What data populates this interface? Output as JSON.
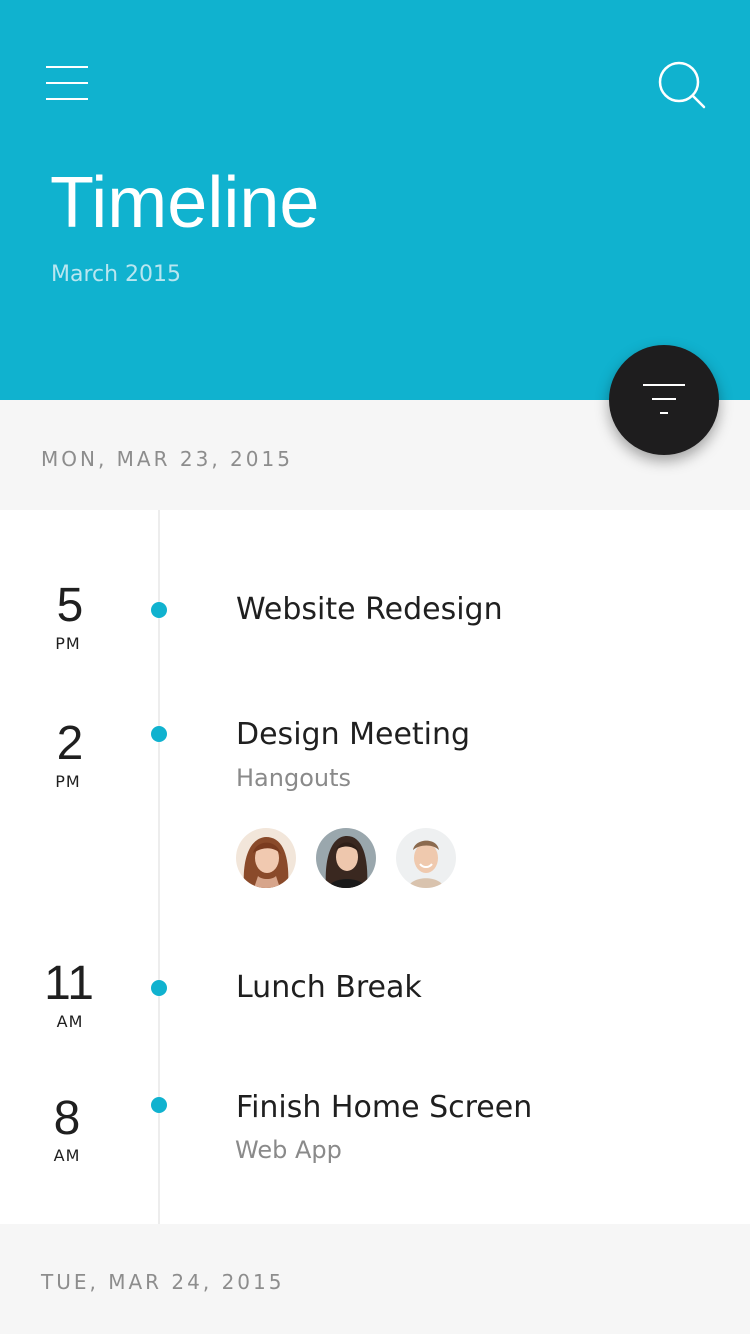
{
  "header": {
    "title": "Timeline",
    "subtitle": "March 2015",
    "background_color": "#10b2cf",
    "menu_icon": "hamburger-menu-icon",
    "search_icon": "search-icon"
  },
  "fab": {
    "icon": "filter-icon",
    "background_color": "#1e1d1e"
  },
  "days": [
    {
      "date": "MON, MAR 23, 2015",
      "events": [
        {
          "hour": "5",
          "period": "PM",
          "title": "Website Redesign",
          "subtitle": ""
        },
        {
          "hour": "2",
          "period": "PM",
          "title": "Design Meeting",
          "subtitle": "Hangouts",
          "attendees": [
            "avatar-woman-red-hair",
            "avatar-woman-dark-hair",
            "avatar-man-smiling"
          ]
        },
        {
          "hour": "11",
          "period": "AM",
          "title": "Lunch Break",
          "subtitle": ""
        },
        {
          "hour": "8",
          "period": "AM",
          "title": "Finish Home Screen",
          "subtitle": "Web App"
        }
      ]
    },
    {
      "date": "TUE, MAR 24, 2015",
      "events": []
    }
  ],
  "accent_color": "#10b2cf"
}
